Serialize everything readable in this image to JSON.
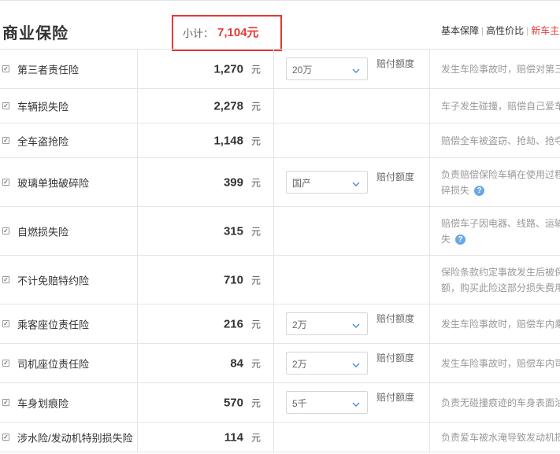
{
  "header": {
    "title": "商业保险",
    "subtotal_label": "小计：",
    "subtotal_value": "7,104元",
    "tabs": [
      {
        "label": "基本保障",
        "active": false
      },
      {
        "label": "高性价比",
        "active": false
      },
      {
        "label": "新车主",
        "active": true
      }
    ]
  },
  "unit": "元",
  "coverage_label": "赔付额度",
  "colors": {
    "accent": "#e53935",
    "help_icon": "#6aa8e8"
  },
  "rows": [
    {
      "name": "第三者责任险",
      "checked": true,
      "price": "1,270",
      "select": "20万",
      "desc": [
        "发生车险事故时，赔偿对第三"
      ],
      "help": false
    },
    {
      "name": "车辆损失险",
      "checked": true,
      "price": "2,278",
      "select": "",
      "desc": [
        "车子发生碰撞，赔偿自己爱车"
      ],
      "help": false
    },
    {
      "name": "全车盗抢险",
      "checked": true,
      "price": "1,148",
      "select": "",
      "desc": [
        "赔偿全车被盗窃、抢劫、抢夺"
      ],
      "help": false
    },
    {
      "name": "玻璃单独破碎险",
      "checked": true,
      "price": "399",
      "select": "国产",
      "desc": [
        "负责赔偿保险车辆在使用过程",
        "碎损失"
      ],
      "help": true
    },
    {
      "name": "自燃损失险",
      "checked": true,
      "price": "315",
      "select": "",
      "desc": [
        "赔偿车子因电器、线路、运输",
        "失"
      ],
      "help": true
    },
    {
      "name": "不计免赔特约险",
      "checked": true,
      "price": "710",
      "select": "",
      "desc": [
        "保险条款约定事故发生后被保",
        "额，购买此险这部分损失费用"
      ],
      "help": false
    },
    {
      "name": "乘客座位责任险",
      "checked": true,
      "price": "216",
      "select": "2万",
      "desc": [
        "发生车险事故时，赔偿车内乘"
      ],
      "help": false
    },
    {
      "name": "司机座位责任险",
      "checked": true,
      "price": "84",
      "select": "2万",
      "desc": [
        "发生车险事故时，赔偿车内司"
      ],
      "help": false
    },
    {
      "name": "车身划痕险",
      "checked": true,
      "price": "570",
      "select": "5千",
      "desc": [
        "负责无碰撞痕迹的车身表面油"
      ],
      "help": false
    },
    {
      "name": "涉水险/发动机特别损失险",
      "checked": true,
      "price": "114",
      "select": "",
      "desc": [
        "负责爱车被水淹导致发动机损"
      ],
      "help": false
    }
  ]
}
